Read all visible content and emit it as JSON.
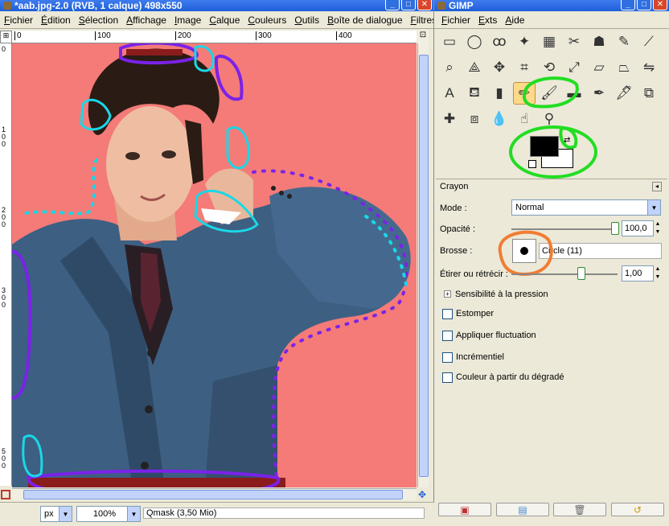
{
  "image_window": {
    "title": "*aab.jpg-2.0 (RVB, 1 calque) 498x550",
    "menu": [
      "Fichier",
      "Édition",
      "Sélection",
      "Affichage",
      "Image",
      "Calque",
      "Couleurs",
      "Outils",
      "Boîte de dialogue",
      "Filtres"
    ],
    "ruler_h_labels": [
      "0",
      "100",
      "200",
      "300",
      "400"
    ],
    "ruler_v_labels": [
      "0",
      "1\n0\n0",
      "2\n0\n0",
      "3\n0\n0",
      "5\n0\n0"
    ],
    "unit": "px",
    "zoom": "100%",
    "status": "Qmask (3,50 Mio)"
  },
  "toolbox": {
    "title": "GIMP",
    "menu": [
      "Fichier",
      "Exts",
      "Aide"
    ],
    "tools": [
      {
        "icon": "rect-select-icon",
        "glyph": "▭"
      },
      {
        "icon": "ellipse-select-icon",
        "glyph": "◯"
      },
      {
        "icon": "lasso-icon",
        "glyph": "ꝏ"
      },
      {
        "icon": "magic-wand-icon",
        "glyph": "✦"
      },
      {
        "icon": "color-select-icon",
        "glyph": "▦"
      },
      {
        "icon": "scissors-icon",
        "glyph": "✂"
      },
      {
        "icon": "foreground-select-icon",
        "glyph": "☗"
      },
      {
        "icon": "paths-icon",
        "glyph": "✎"
      },
      {
        "icon": "color-picker-icon",
        "glyph": "⟋"
      },
      {
        "icon": "zoom-icon",
        "glyph": "⌕"
      },
      {
        "icon": "measure-icon",
        "glyph": "⟁"
      },
      {
        "icon": "move-icon",
        "glyph": "✥"
      },
      {
        "icon": "crop-icon",
        "glyph": "⌗"
      },
      {
        "icon": "rotate-icon",
        "glyph": "⟲"
      },
      {
        "icon": "scale-icon",
        "glyph": "⤢"
      },
      {
        "icon": "shear-icon",
        "glyph": "▱"
      },
      {
        "icon": "perspective-icon",
        "glyph": "⏢"
      },
      {
        "icon": "flip-icon",
        "glyph": "⇋"
      },
      {
        "icon": "text-icon",
        "glyph": "A"
      },
      {
        "icon": "bucket-fill-icon",
        "glyph": "⛾"
      },
      {
        "icon": "blend-icon",
        "glyph": "▮"
      },
      {
        "icon": "pencil-icon",
        "glyph": "✏"
      },
      {
        "icon": "paintbrush-icon",
        "glyph": "🖌"
      },
      {
        "icon": "eraser-icon",
        "glyph": "▬"
      },
      {
        "icon": "airbrush-icon",
        "glyph": "✒"
      },
      {
        "icon": "ink-icon",
        "glyph": "🖋"
      },
      {
        "icon": "clone-icon",
        "glyph": "⧉"
      },
      {
        "icon": "heal-icon",
        "glyph": "✚"
      },
      {
        "icon": "perspective-clone-icon",
        "glyph": "⧈"
      },
      {
        "icon": "blur-icon",
        "glyph": "💧"
      },
      {
        "icon": "smudge-icon",
        "glyph": "☝"
      },
      {
        "icon": "dodge-burn-icon",
        "glyph": "⚲"
      }
    ],
    "options": {
      "header": "Crayon",
      "mode_label": "Mode :",
      "mode_value": "Normal",
      "opacity_label": "Opacité :",
      "opacity_value": "100,0",
      "opacity_fraction": 1.0,
      "brush_label": "Brosse :",
      "brush_value": "Circle (11)",
      "scale_label": "Étirer ou rétrécir :",
      "scale_value": "1,00",
      "pressure_label": "Sensibilité à la pression",
      "checks": [
        "Estomper",
        "Appliquer fluctuation",
        "Incrémentiel",
        "Couleur à partir du dégradé"
      ]
    }
  },
  "colors": {
    "canvas_bg": "#f47b78",
    "annot_purple": "#7b22e8",
    "annot_cyan": "#19d8e8",
    "annot_green": "#22dd22",
    "annot_orange": "#f07d33",
    "foreground": "#000000",
    "background": "#ffffff"
  }
}
